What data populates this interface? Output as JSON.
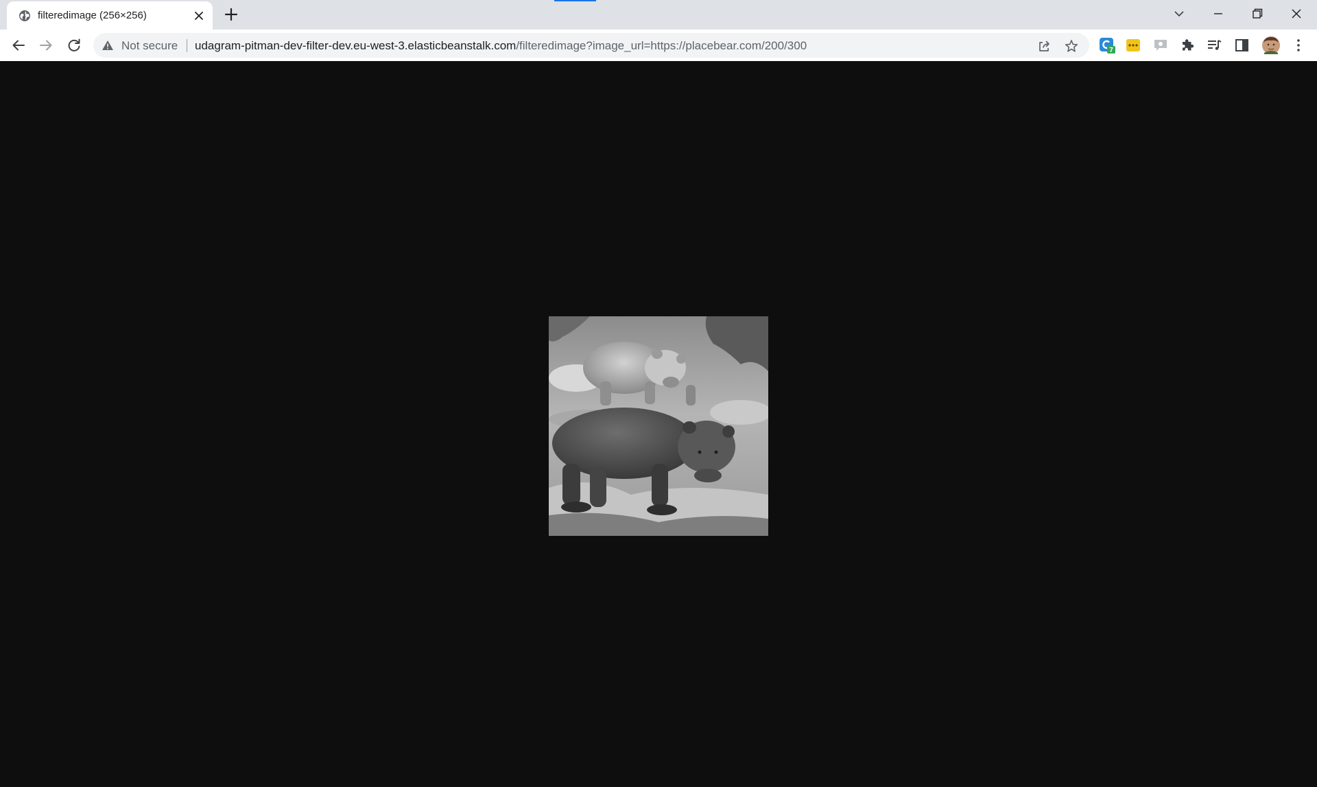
{
  "tab": {
    "title": "filteredimage (256×256)",
    "favicon": "globe-icon"
  },
  "address_bar": {
    "security_text": "Not secure",
    "url_host": "udagram-pitman-dev-filter-dev.eu-west-3.elasticbeanstalk.com",
    "url_path": "/filteredimage?image_url=https://placebear.com/200/300"
  },
  "extensions": {
    "badge_count": "7"
  },
  "colors": {
    "page_background": "#0e0e0e",
    "tabstrip": "#dee1e6",
    "accent": "#1a73e8"
  },
  "icons": {
    "back": "arrow-left-icon",
    "forward": "arrow-right-icon",
    "reload": "reload-icon",
    "warning": "warning-icon",
    "share": "share-icon",
    "bookmark": "star-icon",
    "extensions": "puzzle-icon",
    "media": "media-queue-icon",
    "side_panel": "side-panel-icon",
    "menu": "kebab-menu-icon"
  }
}
